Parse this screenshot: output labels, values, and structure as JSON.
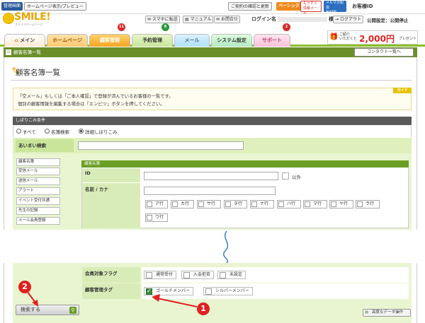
{
  "topbar": {
    "admin_label": "管理画面",
    "preview_label": "ホームページ表示/プレビュー",
    "contract_label": "ご契約の確認と更新",
    "plan_label": "ベーシック",
    "news_label": "もうすぐ",
    "news_label2": "情報メール",
    "mail_label": "メルマガ配信",
    "mail_label2": "無制限",
    "customer_id_label": "お客様ID"
  },
  "header": {
    "logo_text": "SMILE!",
    "logo_sub": "スマイルホームページ",
    "mobile_link": "スマホに転送",
    "manual_link": "マニュアル",
    "contact_link": "お問合せ",
    "login_label": "ログイン名",
    "login_suffix": "様",
    "logout_label": "ログアウト",
    "public_status": "公開設定：公開停止",
    "referral_label": "ご紹介\nいただくと",
    "referral_amount": "2,000円",
    "referral_suffix": "プレゼント"
  },
  "tabs": [
    {
      "label": "メイン"
    },
    {
      "label": "ホームページ"
    },
    {
      "label": "顧客管理",
      "badge": "11"
    },
    {
      "label": "予約管理",
      "badge": "8"
    },
    {
      "label": "メール"
    },
    {
      "label": "システム設定"
    },
    {
      "label": "サポート",
      "badge": "2"
    }
  ],
  "breadcrumb": {
    "label": "顧客名簿一覧",
    "contact_list_button": "コンタクト一覧へ"
  },
  "page": {
    "title": "顧客名簿一覧",
    "guide_tag": "ガイド",
    "guide_line1": "「空メール」もしくは「ご本人確認」で登録が済んでいるお客様の一覧です。",
    "guide_line2": "個別の顧客情報を編集する場合は「エンピツ」ボタンを押してください。"
  },
  "filter": {
    "header": "しぼりこみ条件",
    "radio_all": "すべて",
    "radio_name": "名簿検索",
    "radio_detail": "詳細しぼりこみ",
    "fuzzy_label": "あいまい検索",
    "fuzzy_value": ""
  },
  "side_menu": [
    "顧客名簿",
    "受信メール",
    "送信メール",
    "アラート",
    "イベント受付共通",
    "先生の記録",
    "メール会員登録"
  ],
  "inner": {
    "header": "顧客名簿",
    "id_label": "ID",
    "id_value": "",
    "exclude_label": "以外",
    "name_label": "名前 / カナ",
    "name_value": "",
    "kana_rows": [
      "ア行",
      "カ行",
      "サ行",
      "タ行",
      "ナ行",
      "ハ行",
      "マ行",
      "ヤ行",
      "ラ行",
      "ワ行"
    ]
  },
  "member_flag": {
    "label": "会員対象フラグ",
    "options": [
      "通常受付",
      "入会拒否",
      "未設定"
    ]
  },
  "tag": {
    "label": "顧客管理タグ",
    "options": [
      {
        "label": "ゴールドメンバー",
        "checked": true
      },
      {
        "label": "シルバーメンバー",
        "checked": false
      }
    ]
  },
  "actions": {
    "search_button": "検索する",
    "advanced_button": "高度なデータ操作"
  },
  "annotations": {
    "marker1": "1",
    "marker2": "2"
  },
  "colors": {
    "accent_green": "#8bbf2a",
    "dark_green": "#6a8f2a",
    "light_green": "#dff0bc",
    "marker_red": "#e02020"
  }
}
